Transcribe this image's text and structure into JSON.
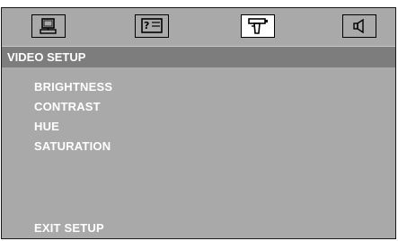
{
  "tabs": [
    {
      "icon": "monitor-icon",
      "active": false
    },
    {
      "icon": "help-dialog-icon",
      "active": false
    },
    {
      "icon": "camera-icon",
      "active": true
    },
    {
      "icon": "speaker-icon",
      "active": false
    }
  ],
  "title": "VIDEO SETUP",
  "menu": {
    "items": [
      "BRIGHTNESS",
      "CONTRAST",
      "HUE",
      "SATURATION"
    ],
    "exit": "EXIT SETUP"
  },
  "colors": {
    "panel": "#a9a9a9",
    "title_bar": "#7d7d7d",
    "text": "#ffffff",
    "active_tab": "#ffffff"
  }
}
